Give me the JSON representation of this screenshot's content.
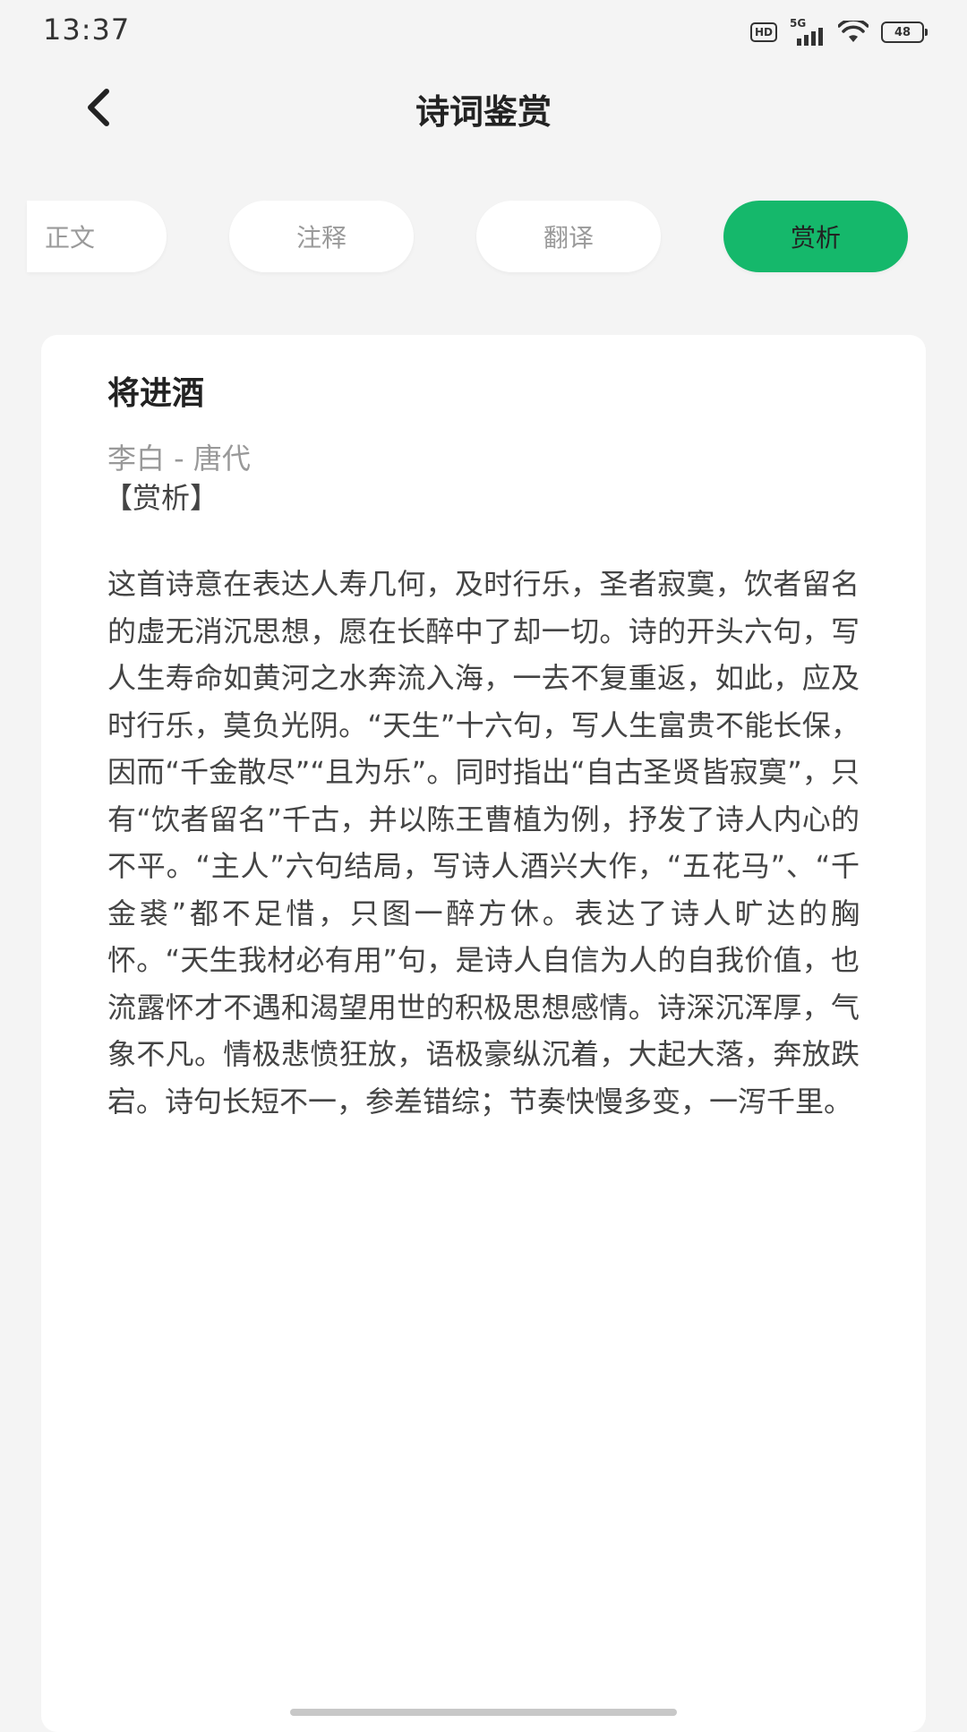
{
  "status_bar": {
    "time": "13:37",
    "hd": "HD",
    "network": "5G",
    "battery": "48"
  },
  "header": {
    "title": "诗词鉴赏"
  },
  "tabs": [
    {
      "label": "正文",
      "active": false
    },
    {
      "label": "注释",
      "active": false
    },
    {
      "label": "翻译",
      "active": false
    },
    {
      "label": "赏析",
      "active": true
    }
  ],
  "poem": {
    "title": "将进酒",
    "author_line": "李白 - 唐代",
    "section_label": "【赏析】",
    "analysis": "这首诗意在表达人寿几何，及时行乐，圣者寂寞，饮者留名的虚无消沉思想，愿在长醉中了却一切。诗的开头六句，写人生寿命如黄河之水奔流入海，一去不复重返，如此，应及时行乐，莫负光阴。“天生”十六句，写人生富贵不能长保，因而“千金散尽”“且为乐”。同时指出“自古圣贤皆寂寞”，只有“饮者留名”千古，并以陈王曹植为例，抒发了诗人内心的不平。“主人”六句结局，写诗人酒兴大作，“五花马”、“千金裘”都不足惜，只图一醉方休。表达了诗人旷达的胸怀。“天生我材必有用”句，是诗人自信为人的自我价值，也流露怀才不遇和渴望用世的积极思想感情。诗深沉浑厚，气象不凡。情极悲愤狂放，语极豪纵沉着，大起大落，奔放跌宕。诗句长短不一，参差错综；节奏快慢多变，一泻千里。"
  },
  "colors": {
    "accent": "#15b86b",
    "background": "#f4f4f4",
    "card": "#ffffff",
    "muted_text": "#999999"
  },
  "icons": {
    "back": "back-arrow-icon",
    "signal": "signal-icon",
    "wifi": "wifi-icon",
    "battery": "battery-icon"
  }
}
